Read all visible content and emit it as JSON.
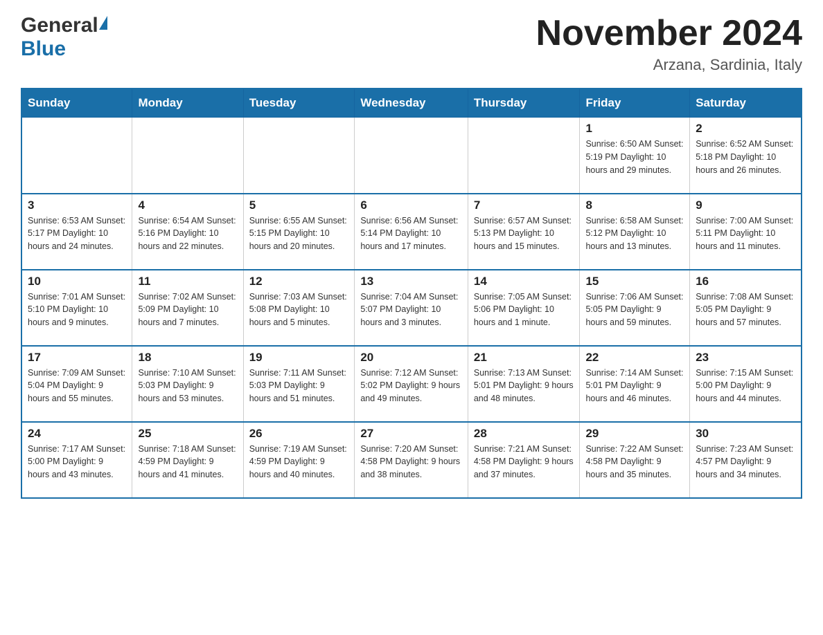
{
  "header": {
    "logo_general": "General",
    "logo_blue": "Blue",
    "month_title": "November 2024",
    "location": "Arzana, Sardinia, Italy"
  },
  "weekdays": [
    "Sunday",
    "Monday",
    "Tuesday",
    "Wednesday",
    "Thursday",
    "Friday",
    "Saturday"
  ],
  "weeks": [
    [
      {
        "day": "",
        "info": ""
      },
      {
        "day": "",
        "info": ""
      },
      {
        "day": "",
        "info": ""
      },
      {
        "day": "",
        "info": ""
      },
      {
        "day": "",
        "info": ""
      },
      {
        "day": "1",
        "info": "Sunrise: 6:50 AM\nSunset: 5:19 PM\nDaylight: 10 hours\nand 29 minutes."
      },
      {
        "day": "2",
        "info": "Sunrise: 6:52 AM\nSunset: 5:18 PM\nDaylight: 10 hours\nand 26 minutes."
      }
    ],
    [
      {
        "day": "3",
        "info": "Sunrise: 6:53 AM\nSunset: 5:17 PM\nDaylight: 10 hours\nand 24 minutes."
      },
      {
        "day": "4",
        "info": "Sunrise: 6:54 AM\nSunset: 5:16 PM\nDaylight: 10 hours\nand 22 minutes."
      },
      {
        "day": "5",
        "info": "Sunrise: 6:55 AM\nSunset: 5:15 PM\nDaylight: 10 hours\nand 20 minutes."
      },
      {
        "day": "6",
        "info": "Sunrise: 6:56 AM\nSunset: 5:14 PM\nDaylight: 10 hours\nand 17 minutes."
      },
      {
        "day": "7",
        "info": "Sunrise: 6:57 AM\nSunset: 5:13 PM\nDaylight: 10 hours\nand 15 minutes."
      },
      {
        "day": "8",
        "info": "Sunrise: 6:58 AM\nSunset: 5:12 PM\nDaylight: 10 hours\nand 13 minutes."
      },
      {
        "day": "9",
        "info": "Sunrise: 7:00 AM\nSunset: 5:11 PM\nDaylight: 10 hours\nand 11 minutes."
      }
    ],
    [
      {
        "day": "10",
        "info": "Sunrise: 7:01 AM\nSunset: 5:10 PM\nDaylight: 10 hours\nand 9 minutes."
      },
      {
        "day": "11",
        "info": "Sunrise: 7:02 AM\nSunset: 5:09 PM\nDaylight: 10 hours\nand 7 minutes."
      },
      {
        "day": "12",
        "info": "Sunrise: 7:03 AM\nSunset: 5:08 PM\nDaylight: 10 hours\nand 5 minutes."
      },
      {
        "day": "13",
        "info": "Sunrise: 7:04 AM\nSunset: 5:07 PM\nDaylight: 10 hours\nand 3 minutes."
      },
      {
        "day": "14",
        "info": "Sunrise: 7:05 AM\nSunset: 5:06 PM\nDaylight: 10 hours\nand 1 minute."
      },
      {
        "day": "15",
        "info": "Sunrise: 7:06 AM\nSunset: 5:05 PM\nDaylight: 9 hours\nand 59 minutes."
      },
      {
        "day": "16",
        "info": "Sunrise: 7:08 AM\nSunset: 5:05 PM\nDaylight: 9 hours\nand 57 minutes."
      }
    ],
    [
      {
        "day": "17",
        "info": "Sunrise: 7:09 AM\nSunset: 5:04 PM\nDaylight: 9 hours\nand 55 minutes."
      },
      {
        "day": "18",
        "info": "Sunrise: 7:10 AM\nSunset: 5:03 PM\nDaylight: 9 hours\nand 53 minutes."
      },
      {
        "day": "19",
        "info": "Sunrise: 7:11 AM\nSunset: 5:03 PM\nDaylight: 9 hours\nand 51 minutes."
      },
      {
        "day": "20",
        "info": "Sunrise: 7:12 AM\nSunset: 5:02 PM\nDaylight: 9 hours\nand 49 minutes."
      },
      {
        "day": "21",
        "info": "Sunrise: 7:13 AM\nSunset: 5:01 PM\nDaylight: 9 hours\nand 48 minutes."
      },
      {
        "day": "22",
        "info": "Sunrise: 7:14 AM\nSunset: 5:01 PM\nDaylight: 9 hours\nand 46 minutes."
      },
      {
        "day": "23",
        "info": "Sunrise: 7:15 AM\nSunset: 5:00 PM\nDaylight: 9 hours\nand 44 minutes."
      }
    ],
    [
      {
        "day": "24",
        "info": "Sunrise: 7:17 AM\nSunset: 5:00 PM\nDaylight: 9 hours\nand 43 minutes."
      },
      {
        "day": "25",
        "info": "Sunrise: 7:18 AM\nSunset: 4:59 PM\nDaylight: 9 hours\nand 41 minutes."
      },
      {
        "day": "26",
        "info": "Sunrise: 7:19 AM\nSunset: 4:59 PM\nDaylight: 9 hours\nand 40 minutes."
      },
      {
        "day": "27",
        "info": "Sunrise: 7:20 AM\nSunset: 4:58 PM\nDaylight: 9 hours\nand 38 minutes."
      },
      {
        "day": "28",
        "info": "Sunrise: 7:21 AM\nSunset: 4:58 PM\nDaylight: 9 hours\nand 37 minutes."
      },
      {
        "day": "29",
        "info": "Sunrise: 7:22 AM\nSunset: 4:58 PM\nDaylight: 9 hours\nand 35 minutes."
      },
      {
        "day": "30",
        "info": "Sunrise: 7:23 AM\nSunset: 4:57 PM\nDaylight: 9 hours\nand 34 minutes."
      }
    ]
  ]
}
